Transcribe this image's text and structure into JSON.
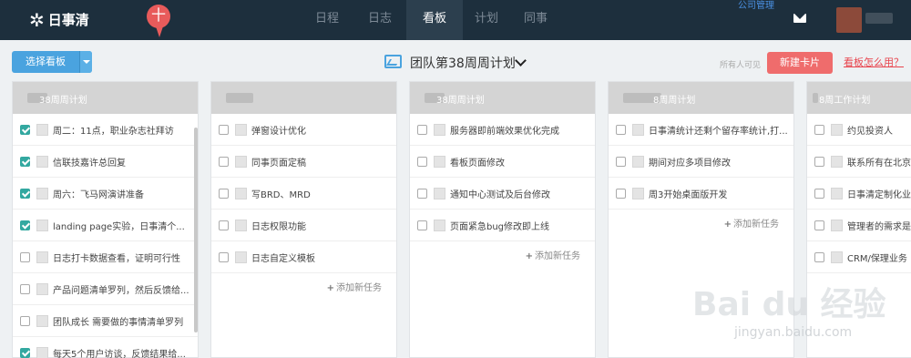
{
  "app": {
    "logo_text": "日事清",
    "pin_text": "十"
  },
  "nav": {
    "tabs": [
      {
        "label": "日程",
        "active": false
      },
      {
        "label": "日志",
        "active": false
      },
      {
        "label": "看板",
        "active": true
      },
      {
        "label": "计划",
        "active": false
      },
      {
        "label": "同事",
        "active": false
      }
    ],
    "company_link": "公司管理"
  },
  "toolbar": {
    "select_board": "选择看板",
    "board_title": "团队第38周周计划",
    "visibility": "所有人可见",
    "new_card": "新建卡片",
    "help_link": "看板怎么用？"
  },
  "add_task_label": "添加新任务",
  "columns": [
    {
      "title": "38周周计划",
      "tasks": [
        {
          "text": "周二：11点，职业杂志社拜访",
          "done": true
        },
        {
          "text": "信联技嘉许总回复",
          "done": true
        },
        {
          "text": "周六：飞马网演讲准备",
          "done": true
        },
        {
          "text": "landing page实验，日事清个...",
          "done": true
        },
        {
          "text": "日志打卡数据查看，证明可行性",
          "done": false
        },
        {
          "text": "产品问题清单罗列，然后反馈给...",
          "done": false
        },
        {
          "text": "团队成长 需要做的事情清单罗列",
          "done": false
        },
        {
          "text": "每天5个用户访谈，反馈结果给...",
          "done": true
        }
      ]
    },
    {
      "title": "",
      "tasks": [
        {
          "text": "弹窗设计优化",
          "done": false
        },
        {
          "text": "同事页面定稿",
          "done": false
        },
        {
          "text": "写BRD、MRD",
          "done": false
        },
        {
          "text": "日志权限功能",
          "done": false
        },
        {
          "text": "日志自定义模板",
          "done": false
        }
      ]
    },
    {
      "title": "38周周计划",
      "tasks": [
        {
          "text": "服务器即前端效果优化完成",
          "done": false
        },
        {
          "text": "看板页面修改",
          "done": false
        },
        {
          "text": "通知中心测试及后台修改",
          "done": false
        },
        {
          "text": "页面紧急bug修改即上线",
          "done": false
        }
      ]
    },
    {
      "title": "8周周计划",
      "tasks": [
        {
          "text": "日事清统计还剩个留存率统计,打...",
          "done": false
        },
        {
          "text": "期间对应多项目修改",
          "done": false
        },
        {
          "text": "周3开始桌面版开发",
          "done": false
        }
      ]
    },
    {
      "title": "8周工作计划",
      "tasks": [
        {
          "text": "约见投资人",
          "done": false
        },
        {
          "text": "联系所有在北京",
          "done": false
        },
        {
          "text": "日事清定制化业",
          "done": false
        },
        {
          "text": "管理者的需求是",
          "done": false
        },
        {
          "text": "CRM/保理业务",
          "done": false
        }
      ]
    }
  ],
  "watermark": {
    "main": "Bai du 经验",
    "sub": "jingyan.baidu.com"
  }
}
